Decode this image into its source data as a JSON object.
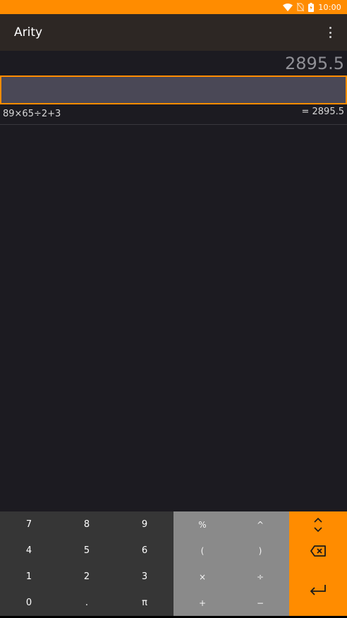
{
  "status_bar": {
    "time": "10:00",
    "icons": [
      "wifi-icon",
      "no-sim-icon",
      "battery-icon"
    ]
  },
  "app_bar": {
    "title": "Arity",
    "menu_icon": "more-vert-icon"
  },
  "display": {
    "result": "2895.5",
    "input_value": ""
  },
  "history": [
    {
      "expression": "89×65÷2+3",
      "result": "= 2895.5"
    }
  ],
  "keypad": {
    "digits": [
      [
        "7",
        "8",
        "9"
      ],
      [
        "4",
        "5",
        "6"
      ],
      [
        "1",
        "2",
        "3"
      ],
      [
        "0",
        ".",
        "π"
      ]
    ],
    "operators": [
      [
        "%",
        "^"
      ],
      [
        "(",
        ")"
      ],
      [
        "×",
        "÷"
      ],
      [
        "+",
        "−"
      ]
    ],
    "actions": [
      "expand-collapse-icon",
      "backspace-icon",
      "enter-icon"
    ]
  },
  "colors": {
    "accent": "#ff8c00",
    "background": "#1c1b21",
    "app_bar": "#2d2724",
    "input_bg": "#4a4856",
    "digit_pad": "#363636",
    "operator_pad": "#8a8a8a"
  }
}
